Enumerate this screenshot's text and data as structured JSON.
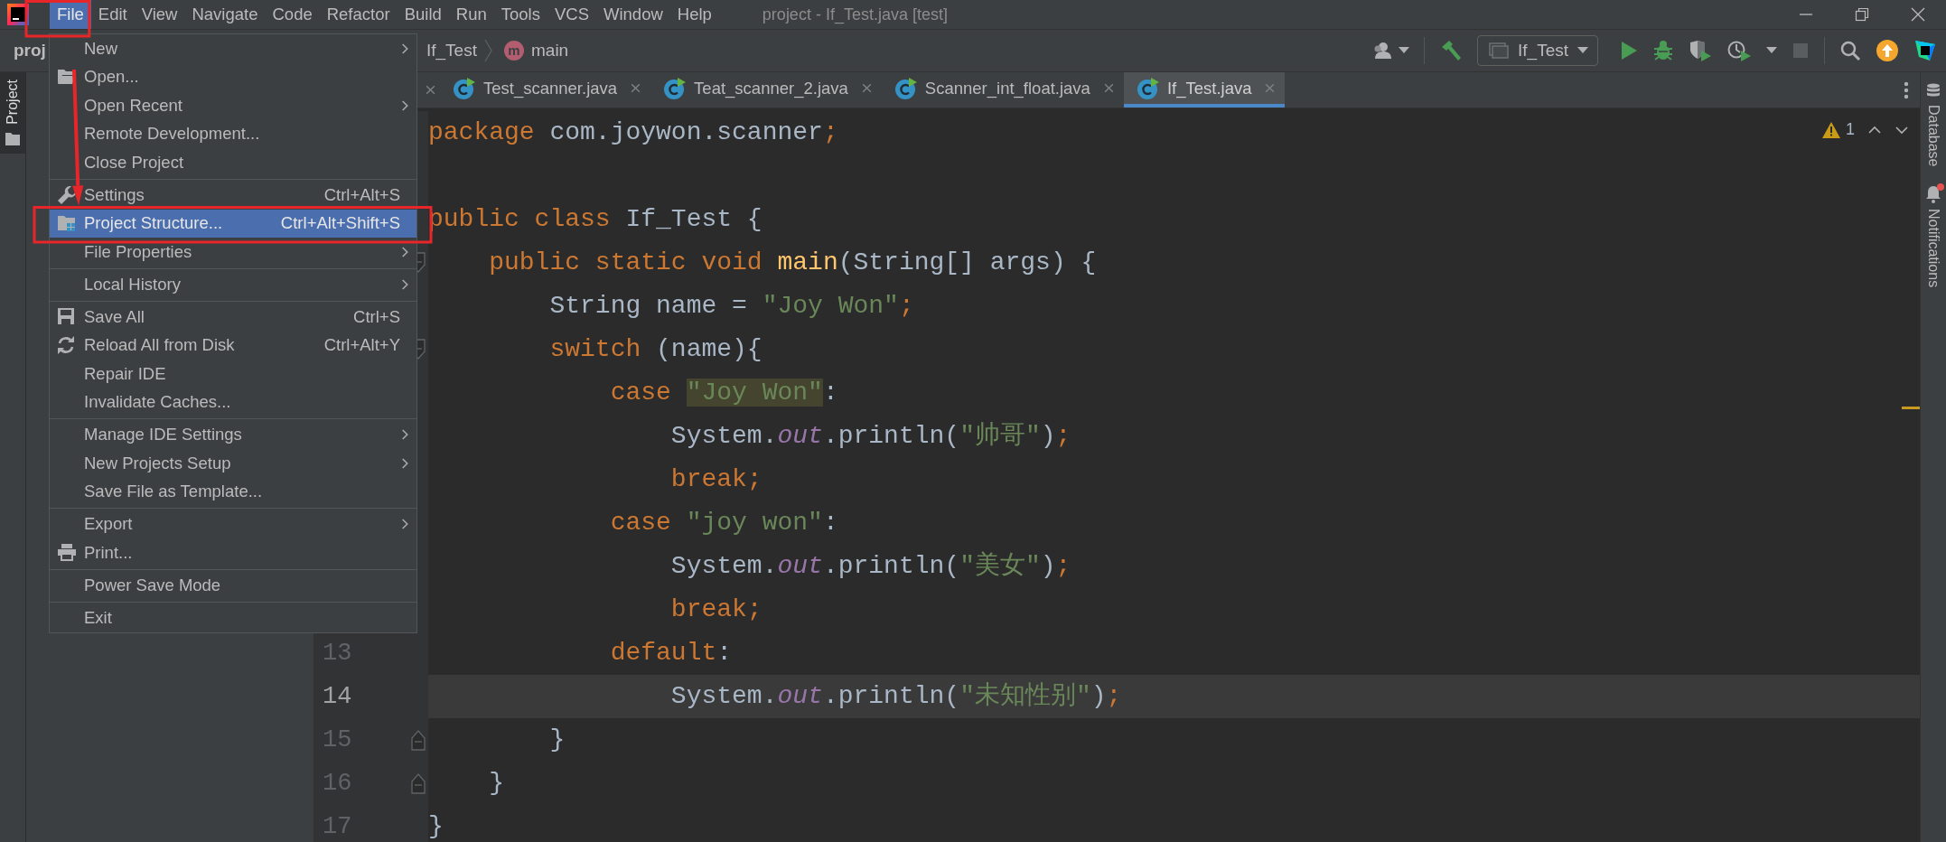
{
  "window": {
    "title": "project - If_Test.java [test]"
  },
  "menu_bar": [
    {
      "label": "File",
      "selected": true,
      "outlined": true
    },
    {
      "label": "Edit",
      "selected": false,
      "outlined": false
    },
    {
      "label": "View",
      "selected": false,
      "outlined": false
    },
    {
      "label": "Navigate",
      "selected": false,
      "outlined": false
    },
    {
      "label": "Code",
      "selected": false,
      "outlined": false
    },
    {
      "label": "Refactor",
      "selected": false,
      "outlined": false
    },
    {
      "label": "Build",
      "selected": false,
      "outlined": false
    },
    {
      "label": "Run",
      "selected": false,
      "outlined": false
    },
    {
      "label": "Tools",
      "selected": false,
      "outlined": false
    },
    {
      "label": "VCS",
      "selected": false,
      "outlined": false
    },
    {
      "label": "Window",
      "selected": false,
      "outlined": false
    },
    {
      "label": "Help",
      "selected": false,
      "outlined": false
    }
  ],
  "toolbar": {
    "project": "proj",
    "breadcrumb": [
      {
        "label": "If_Test"
      },
      {
        "badge": "m",
        "label": "main"
      }
    ],
    "run_config": "If_Test"
  },
  "left_strip": [
    {
      "label": "Project",
      "selected": true
    }
  ],
  "tabs": [
    {
      "label": "Test_scanner.java",
      "selected": false
    },
    {
      "label": "Teat_scanner_2.java",
      "selected": false
    },
    {
      "label": "Scanner_int_float.java",
      "selected": false
    },
    {
      "label": "If_Test.java",
      "selected": true
    }
  ],
  "editor": {
    "warnings": "1",
    "lines": [
      {
        "current": false,
        "tokens": [
          {
            "kind": "keyword",
            "text": "package"
          },
          {
            "kind": "plain",
            "text": " com.joywon.scanner"
          },
          {
            "kind": "keyword",
            "text": ";"
          }
        ]
      },
      {
        "current": false
      },
      {
        "current": false,
        "tokens": [
          {
            "kind": "keyword",
            "text": "public class"
          },
          {
            "kind": "plain",
            "text": " If_Test {"
          }
        ]
      },
      {
        "current": false,
        "fold_start": true,
        "fold_end": false,
        "tokens": [
          {
            "kind": "keyword",
            "text": "    public static void "
          },
          {
            "kind": "method",
            "text": "main"
          },
          {
            "kind": "plain",
            "text": "(String[] args) {"
          }
        ]
      },
      {
        "current": false,
        "tokens": [
          {
            "kind": "plain",
            "text": "        String name = "
          },
          {
            "kind": "string",
            "text": "\"Joy Won\""
          },
          {
            "kind": "keyword",
            "text": ";"
          }
        ]
      },
      {
        "current": false,
        "fold_start": true,
        "fold_end": false,
        "tokens": [
          {
            "kind": "keyword",
            "text": "        switch"
          },
          {
            "kind": "plain",
            "text": " (name){"
          }
        ]
      },
      {
        "current": false,
        "tokens": [
          {
            "kind": "keyword",
            "text": "            case "
          },
          {
            "kind": "match",
            "text": "\"Joy Won\""
          },
          {
            "kind": "plain",
            "text": ":"
          }
        ]
      },
      {
        "current": false,
        "tokens": [
          {
            "kind": "plain",
            "text": "                System."
          },
          {
            "kind": "field",
            "text": "out"
          },
          {
            "kind": "plain",
            "text": ".println("
          },
          {
            "kind": "string",
            "text": "\"帅哥\""
          },
          {
            "kind": "plain",
            "text": ")"
          },
          {
            "kind": "keyword",
            "text": ";"
          }
        ]
      },
      {
        "current": false,
        "tokens": [
          {
            "kind": "keyword",
            "text": "                break;"
          }
        ]
      },
      {
        "current": false,
        "tokens": [
          {
            "kind": "keyword",
            "text": "            case "
          },
          {
            "kind": "string",
            "text": "\"joy won\""
          },
          {
            "kind": "plain",
            "text": ":"
          }
        ]
      },
      {
        "current": false,
        "tokens": [
          {
            "kind": "plain",
            "text": "                System."
          },
          {
            "kind": "field",
            "text": "out"
          },
          {
            "kind": "plain",
            "text": ".println("
          },
          {
            "kind": "string",
            "text": "\"美女\""
          },
          {
            "kind": "plain",
            "text": ")"
          },
          {
            "kind": "keyword",
            "text": ";"
          }
        ]
      },
      {
        "current": false,
        "tokens": [
          {
            "kind": "keyword",
            "text": "                break;"
          }
        ]
      },
      {
        "current": false,
        "number": "13",
        "tokens": [
          {
            "kind": "keyword",
            "text": "            default"
          },
          {
            "kind": "plain",
            "text": ":"
          }
        ]
      },
      {
        "current": true,
        "number": "14",
        "tokens": [
          {
            "kind": "plain",
            "text": "                System."
          },
          {
            "kind": "field",
            "text": "out"
          },
          {
            "kind": "plain",
            "text": ".println("
          },
          {
            "kind": "string",
            "text": "\"未知性别\""
          },
          {
            "kind": "plain",
            "text": ")"
          },
          {
            "kind": "keyword",
            "text": ";"
          }
        ]
      },
      {
        "current": false,
        "number": "15",
        "fold_start": false,
        "fold_end": true,
        "tokens": [
          {
            "kind": "plain",
            "text": "        }"
          }
        ]
      },
      {
        "current": false,
        "number": "16",
        "fold_start": false,
        "fold_end": true,
        "tokens": [
          {
            "kind": "plain",
            "text": "    }"
          }
        ]
      },
      {
        "current": false,
        "number": "17",
        "tokens": [
          {
            "kind": "plain",
            "text": "}"
          }
        ]
      }
    ]
  },
  "right_strip": [
    {
      "label": "Database",
      "kind": "database",
      "unread": false
    },
    {
      "label": "Notifications",
      "kind": "notifications",
      "unread": true
    }
  ],
  "file_menu": [
    {
      "kind": "plain",
      "label": "New",
      "submenu": true,
      "selected": false,
      "outlined": false
    },
    {
      "kind": "folder",
      "label": "Open...",
      "submenu": false,
      "selected": false,
      "outlined": false
    },
    {
      "kind": "plain",
      "label": "Open Recent",
      "submenu": true,
      "selected": false,
      "outlined": false
    },
    {
      "kind": "plain",
      "label": "Remote Development...",
      "submenu": false,
      "selected": false,
      "outlined": false
    },
    {
      "kind": "plain",
      "label": "Close Project",
      "submenu": false,
      "selected": false,
      "outlined": false
    },
    {
      "kind": "separator"
    },
    {
      "kind": "wrench",
      "label": "Settings",
      "shortcut": "Ctrl+Alt+S",
      "submenu": false,
      "selected": false,
      "outlined": false
    },
    {
      "kind": "structure",
      "label": "Project Structure...",
      "shortcut": "Ctrl+Alt+Shift+S",
      "submenu": false,
      "selected": true,
      "outlined": true
    },
    {
      "kind": "plain",
      "label": "File Properties",
      "submenu": true,
      "selected": false,
      "outlined": false
    },
    {
      "kind": "separator"
    },
    {
      "kind": "plain",
      "label": "Local History",
      "submenu": true,
      "selected": false,
      "outlined": false
    },
    {
      "kind": "separator"
    },
    {
      "kind": "floppy",
      "label": "Save All",
      "shortcut": "Ctrl+S",
      "submenu": false,
      "selected": false,
      "outlined": false
    },
    {
      "kind": "refresh",
      "label": "Reload All from Disk",
      "shortcut": "Ctrl+Alt+Y",
      "submenu": false,
      "selected": false,
      "outlined": false
    },
    {
      "kind": "plain",
      "label": "Repair IDE",
      "submenu": false,
      "selected": false,
      "outlined": false
    },
    {
      "kind": "plain",
      "label": "Invalidate Caches...",
      "submenu": false,
      "selected": false,
      "outlined": false
    },
    {
      "kind": "separator"
    },
    {
      "kind": "plain",
      "label": "Manage IDE Settings",
      "submenu": true,
      "selected": false,
      "outlined": false
    },
    {
      "kind": "plain",
      "label": "New Projects Setup",
      "submenu": true,
      "selected": false,
      "outlined": false
    },
    {
      "kind": "plain",
      "label": "Save File as Template...",
      "submenu": false,
      "selected": false,
      "outlined": false
    },
    {
      "kind": "separator"
    },
    {
      "kind": "plain",
      "label": "Export",
      "submenu": true,
      "selected": false,
      "outlined": false
    },
    {
      "kind": "printer",
      "label": "Print...",
      "submenu": false,
      "selected": false,
      "outlined": false
    },
    {
      "kind": "separator"
    },
    {
      "kind": "plain",
      "label": "Power Save Mode",
      "submenu": false,
      "selected": false,
      "outlined": false
    },
    {
      "kind": "separator"
    },
    {
      "kind": "plain",
      "label": "Exit",
      "submenu": false,
      "selected": false,
      "outlined": false
    }
  ],
  "annotation_arrow": true
}
